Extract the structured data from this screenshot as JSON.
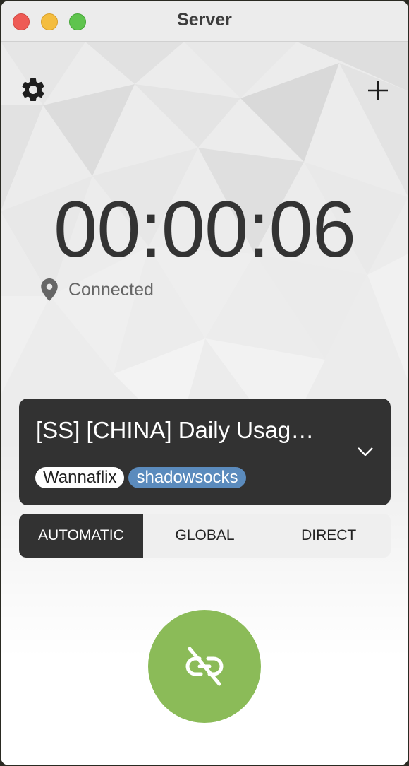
{
  "window": {
    "title": "Server"
  },
  "toolbar": {
    "settings_icon": "gear-icon",
    "add_icon": "plus-icon"
  },
  "timer": {
    "elapsed": "00:00:06"
  },
  "status": {
    "icon": "location-pin-icon",
    "text": "Connected"
  },
  "server": {
    "name": "[SS] [CHINA] Daily Usag…",
    "tags": [
      "Wannaflix",
      "shadowsocks"
    ],
    "dropdown_icon": "chevron-down-icon"
  },
  "modes": {
    "items": [
      "AUTOMATIC",
      "GLOBAL",
      "DIRECT"
    ],
    "selected": "AUTOMATIC"
  },
  "connect_button": {
    "icon": "unlink-icon",
    "color": "#8bbb58"
  },
  "colors": {
    "card": "#323232",
    "tag_blue": "#5b8bbd",
    "accent_green": "#8bbb58"
  }
}
